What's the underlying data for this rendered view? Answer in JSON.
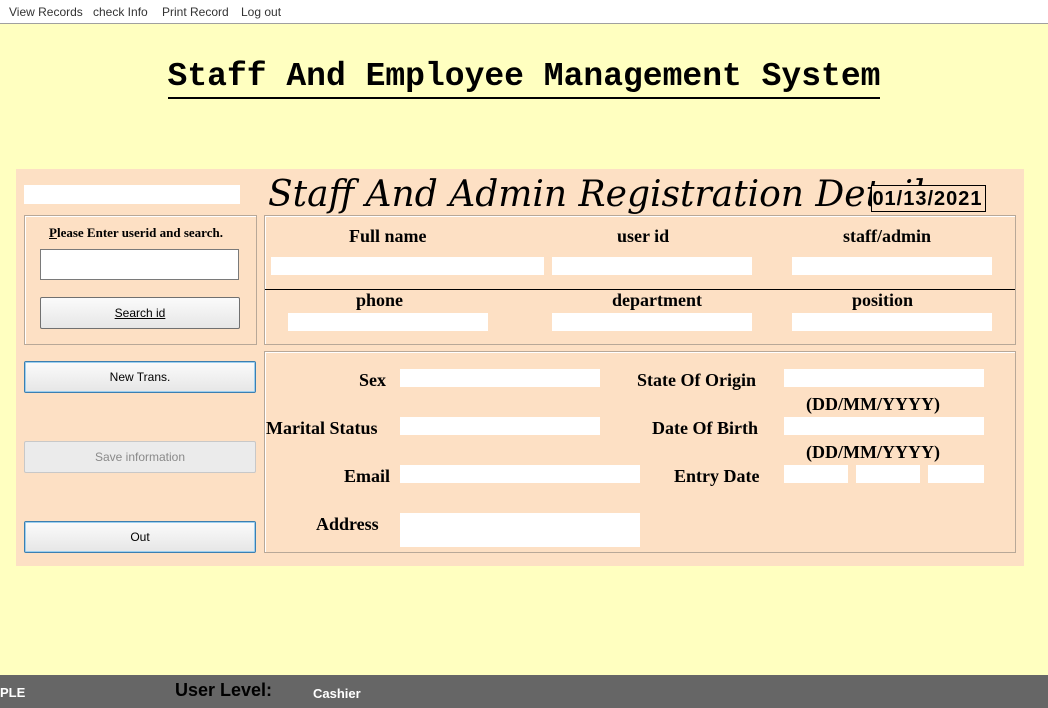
{
  "menu": {
    "items": [
      "View Records",
      "check Info",
      "Print Record",
      "Log out"
    ]
  },
  "main_title": "Staff And Employee Management System",
  "form": {
    "title": "Staff And Admin Registration Details",
    "date": "01/13/2021",
    "search": {
      "prompt_prefix": "P",
      "prompt_rest": "lease Enter userid and search.",
      "input_value": "",
      "button_label": "Search id"
    },
    "buttons": {
      "new_trans": "New Trans.",
      "save_info": "Save information",
      "out": "Out"
    },
    "top_fields": {
      "full_name": "Full name",
      "user_id": "user id",
      "staff_admin": "staff/admin",
      "phone": "phone",
      "department": "department",
      "position": "position"
    },
    "detail_fields": {
      "sex": "Sex",
      "marital_status": "Marital Status",
      "email": "Email",
      "address": "Address",
      "state_of_origin": "State Of Origin",
      "date_of_birth": "Date Of Birth",
      "entry_date": "Entry Date",
      "date_format_hint_1": "(DD/MM/YYYY)",
      "date_format_hint_2": "(DD/MM/YYYY)"
    }
  },
  "status_bar": {
    "left_text": "PLE",
    "user_level_label": "User Level:",
    "user_level_value": "Cashier"
  },
  "colors": {
    "background": "#ffffc0",
    "panel": "#fde0c4",
    "status_bar": "#666666"
  }
}
